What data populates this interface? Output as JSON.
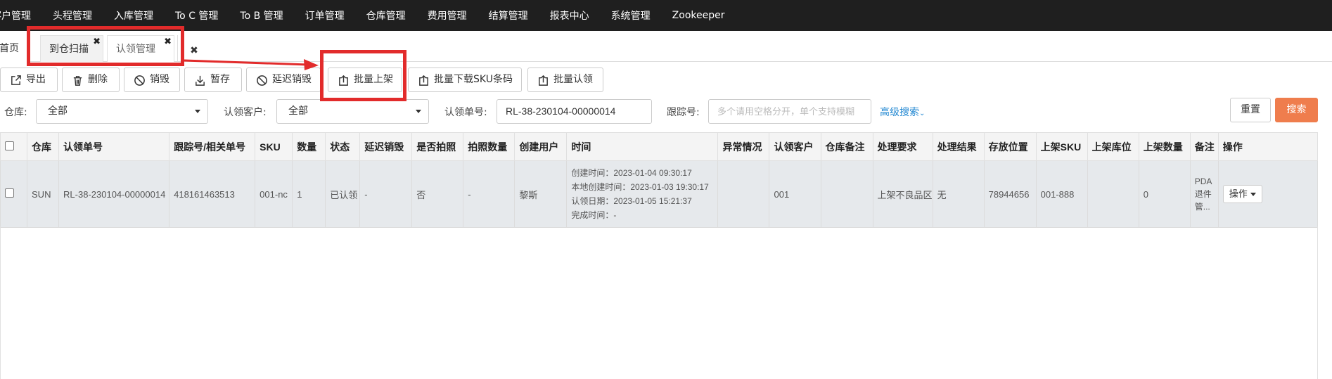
{
  "top_nav": {
    "items": [
      "客户管理",
      "头程管理",
      "入库管理",
      "To C 管理",
      "To B 管理",
      "订单管理",
      "仓库管理",
      "费用管理",
      "结算管理",
      "报表中心",
      "系统管理",
      "Zookeeper"
    ]
  },
  "tabs": {
    "home": "首页",
    "scan": "到仓扫描",
    "claim": "认领管理",
    "close_mark": "✖"
  },
  "toolbar": {
    "export": "导出",
    "delete": "删除",
    "destroy": "销毁",
    "hold": "暂存",
    "delay_destroy": "延迟销毁",
    "batch_shelve": "批量上架",
    "batch_download_sku": "批量下载SKU条码",
    "batch_claim": "批量认领"
  },
  "filters": {
    "warehouse_label": "仓库:",
    "warehouse_value": "全部",
    "customer_label": "认领客户:",
    "customer_value": "全部",
    "claim_no_label": "认领单号:",
    "claim_no_value": "RL-38-230104-00000014",
    "tracking_label": "跟踪号:",
    "tracking_placeholder": "多个请用空格分开，单个支持模糊",
    "advanced_search": "高级搜索",
    "reset": "重置",
    "search": "搜索"
  },
  "table": {
    "headers": [
      "仓库",
      "认领单号",
      "跟踪号/相关单号",
      "SKU",
      "数量",
      "状态",
      "延迟销毁",
      "是否拍照",
      "拍照数量",
      "创建用户",
      "时间",
      "异常情况",
      "认领客户",
      "仓库备注",
      "处理要求",
      "处理结果",
      "存放位置",
      "上架SKU",
      "上架库位",
      "上架数量",
      "备注",
      "操作"
    ],
    "row": {
      "warehouse": "SUN",
      "claim_no": "RL-38-230104-00000014",
      "tracking": "418161463513",
      "sku": "001-nc",
      "qty": "1",
      "status": "已认领",
      "delay_destroy": "-",
      "photo": "否",
      "photo_qty": "-",
      "creator": "黎斯",
      "time_created": "创建时间：2023-01-04 09:30:17",
      "time_local": "本地创建时间：2023-01-03 19:30:17",
      "time_claim": "认领日期：2023-01-05 15:21:37",
      "time_done": "完成时间：-",
      "exception": "",
      "customer": "001",
      "wh_note": "",
      "requirement": "上架不良品区",
      "result": "无",
      "location": "78944656",
      "shelf_sku": "001-888",
      "shelf_loc": "",
      "shelf_qty": "0",
      "remark": "PDA退件管...",
      "action": "操作"
    }
  },
  "colors": {
    "nav_bg": "#1f1f1f",
    "search_btn": "#ef7d4d",
    "link": "#1f86d1",
    "annotation": "#e22b2b",
    "row_bg": "#e6e9ec"
  }
}
